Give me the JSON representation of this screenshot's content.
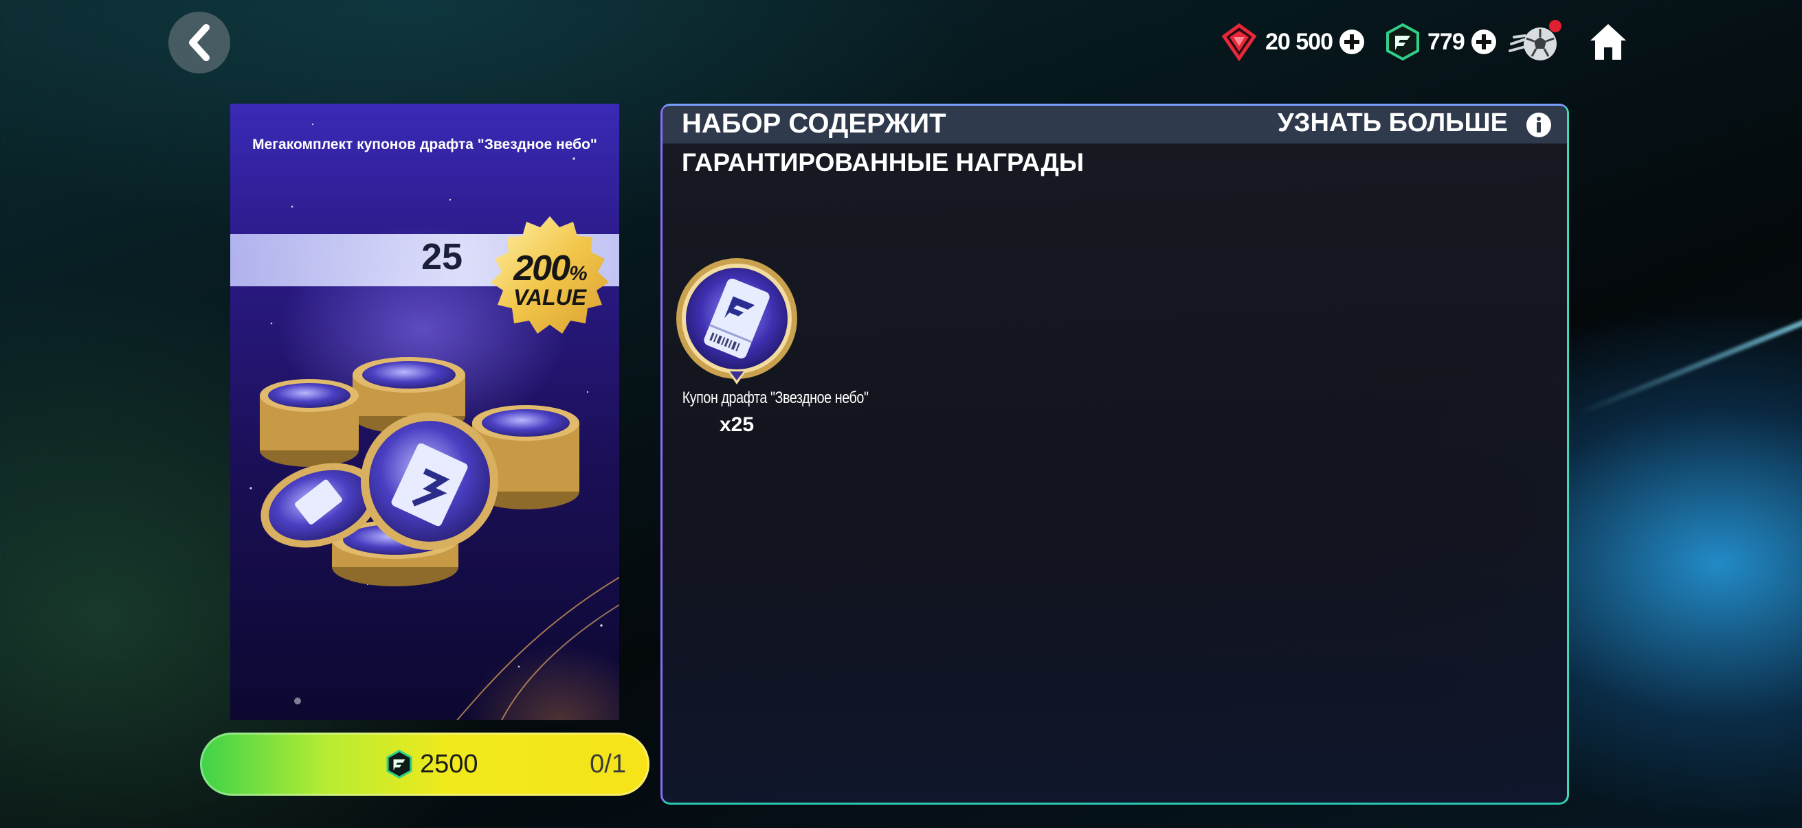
{
  "topbar": {
    "gems": {
      "value": "20 500",
      "icon": "red-gem-icon"
    },
    "coins": {
      "value": "779",
      "icon": "fc-points-icon"
    },
    "icons": [
      "soccer-ball-icon",
      "home-icon"
    ],
    "notification_color": "#e02030"
  },
  "pack": {
    "title": "Мегакомплект купонов драфта \"Звездное небо\"",
    "count": "25",
    "badge_percent": "200",
    "badge_percent_sign": "%",
    "badge_value": "VALUE"
  },
  "purchase": {
    "price": "2500",
    "limit": "0/1",
    "currency_icon": "fc-points-icon"
  },
  "panel": {
    "title": "НАБОР СОДЕРЖИТ",
    "learn_more": "УЗНАТЬ БОЛЬШЕ",
    "section": "ГАРАНТИРОВАННЫЕ НАГРАДЫ",
    "rewards": [
      {
        "name": "Купон драфта \"Звездное небо\"",
        "quantity": "x25",
        "icon": "draft-voucher-icon"
      }
    ]
  },
  "colors": {
    "gold": "#d9a441",
    "button_gradient_start": "#3ed24a",
    "button_gradient_end": "#f6e31a",
    "panel_header": "#2f3a4c"
  }
}
